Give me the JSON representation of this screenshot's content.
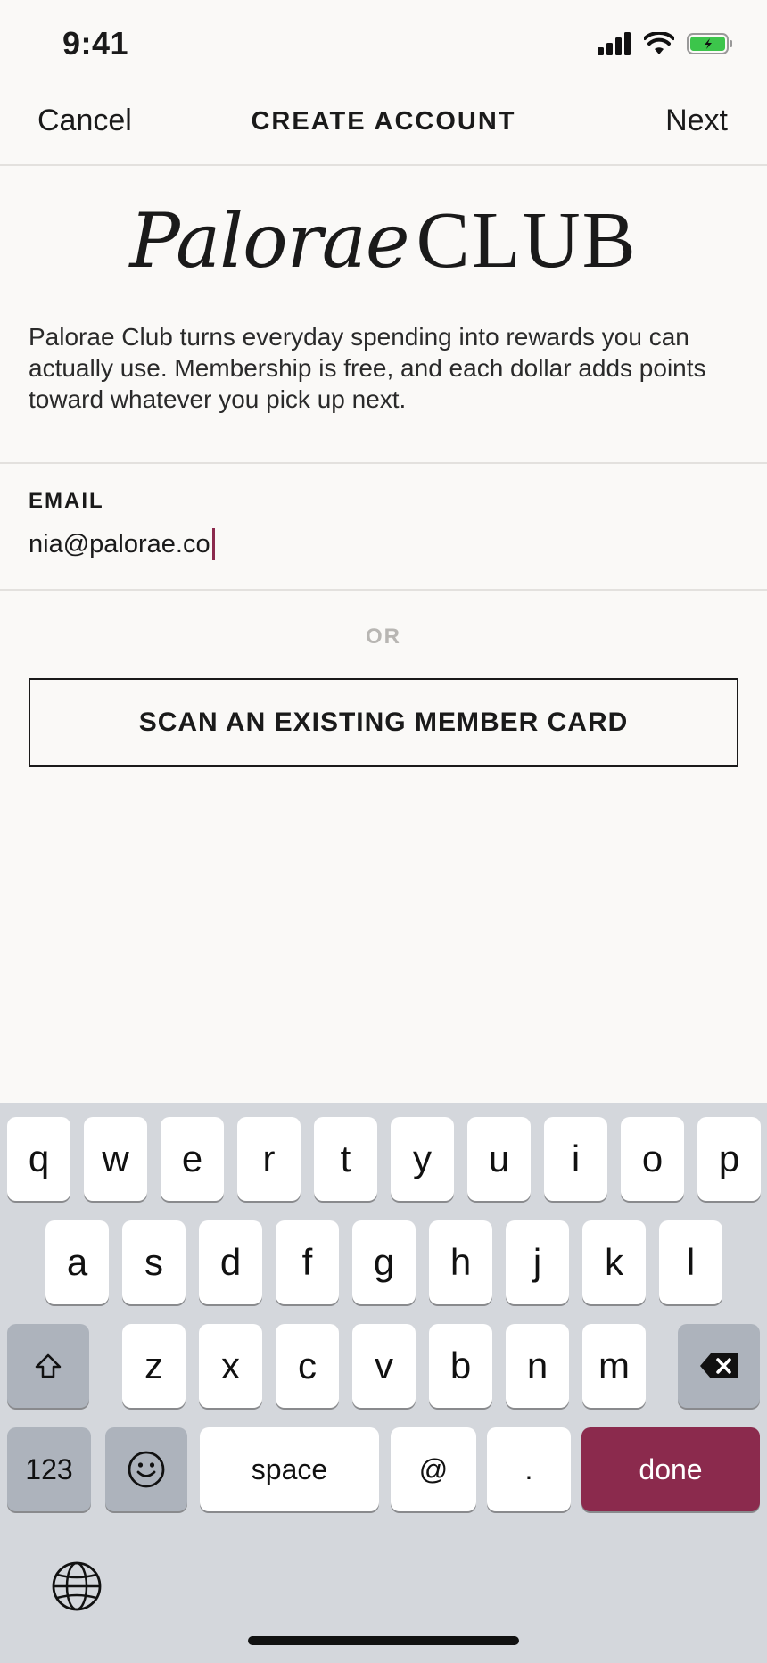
{
  "status": {
    "time": "9:41",
    "icons": [
      "signal-icon",
      "wifi-icon",
      "battery-icon"
    ],
    "battery_color": "#3cc54b"
  },
  "nav": {
    "cancel": "Cancel",
    "title": "CREATE ACCOUNT",
    "next": "Next"
  },
  "brand": {
    "script": "Palorae",
    "club": "CLUB"
  },
  "intro": "Palorae Club turns everyday spending into rewards you can actually use. Membership is free, and each dollar adds points toward whatever you pick up next.",
  "email": {
    "label": "EMAIL",
    "value": "nia@palorae.co"
  },
  "or_text": "OR",
  "scan_button": "SCAN AN EXISTING MEMBER CARD",
  "keyboard": {
    "row1": [
      "q",
      "w",
      "e",
      "r",
      "t",
      "y",
      "u",
      "i",
      "o",
      "p"
    ],
    "row2": [
      "a",
      "s",
      "d",
      "f",
      "g",
      "h",
      "j",
      "k",
      "l"
    ],
    "row3": [
      "z",
      "x",
      "c",
      "v",
      "b",
      "n",
      "m"
    ],
    "numbers": "123",
    "space": "space",
    "at": "@",
    "dot": ".",
    "done": "done",
    "icons": [
      "shift-icon",
      "backspace-icon",
      "emoji-icon",
      "globe-icon"
    ]
  },
  "colors": {
    "accent": "#8b2a4d",
    "background": "#faf9f7"
  }
}
